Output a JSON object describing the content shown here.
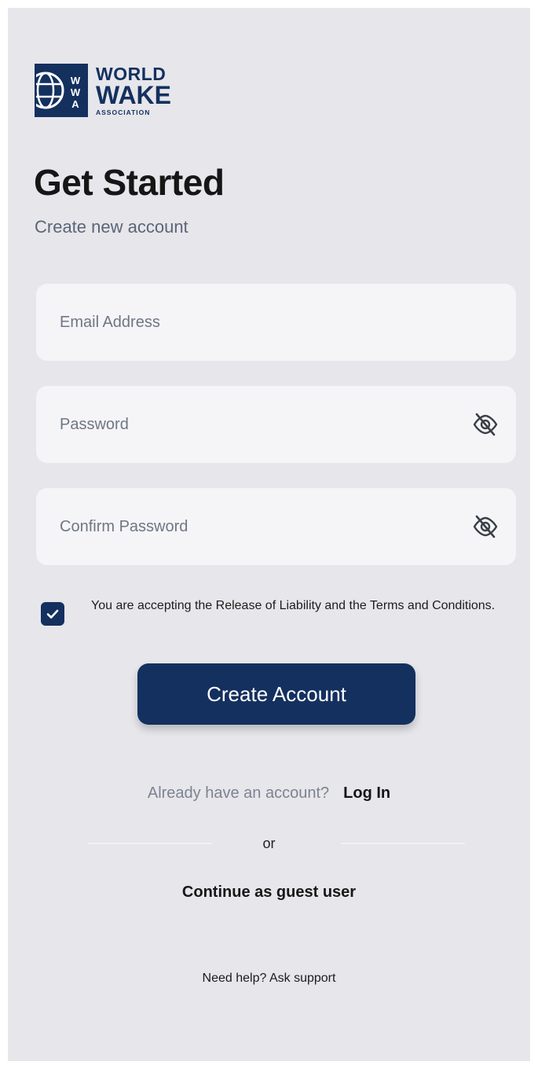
{
  "brand": {
    "line1": "WORLD",
    "line2": "WAKE",
    "line3": "ASSOCIATION",
    "color": "#14305f"
  },
  "header": {
    "title": "Get Started",
    "subtitle": "Create new account"
  },
  "form": {
    "email_placeholder": "Email Address",
    "password_placeholder": "Password",
    "confirm_placeholder": "Confirm Password",
    "visibility_icon": "eye-slash-icon"
  },
  "terms": {
    "checked": true,
    "text": "You are accepting the Release of Liability and the Terms and Conditions."
  },
  "actions": {
    "create_label": "Create Account",
    "login_question": "Already have an account?",
    "login_link": "Log In",
    "or_label": "or",
    "guest_label": "Continue as guest user",
    "help_label": "Need help? Ask support"
  },
  "colors": {
    "primary": "#14305f",
    "background": "#e6e6eb",
    "field": "#f5f5f7"
  }
}
